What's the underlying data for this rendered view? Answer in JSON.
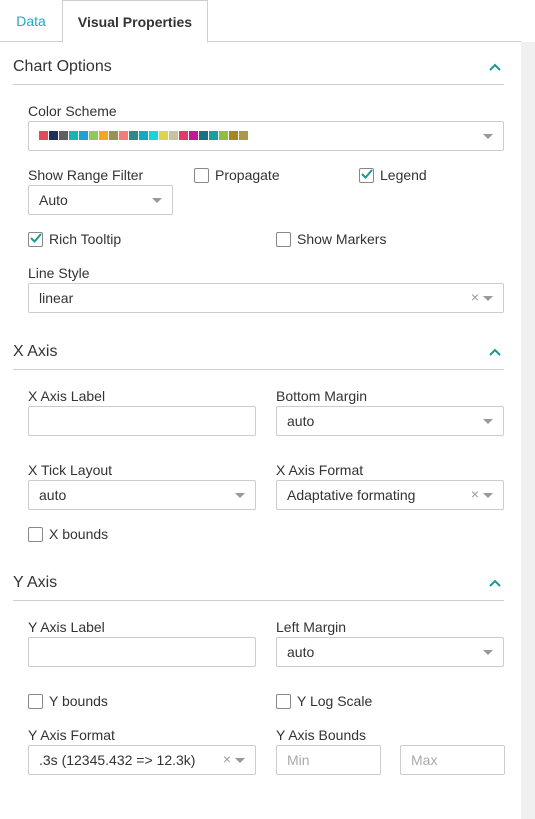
{
  "tabs": [
    {
      "label": "Data"
    },
    {
      "label": "Visual Properties"
    }
  ],
  "sections": {
    "chart_options": {
      "title": "Chart Options",
      "color_scheme": {
        "label": "Color Scheme",
        "colors": [
          "#e34b5a",
          "#1f2e5a",
          "#5f5f5f",
          "#12b8b0",
          "#1fa3d4",
          "#8cca5b",
          "#f2a91b",
          "#9e8f58",
          "#f37b7b",
          "#2b8c87",
          "#13a8c5",
          "#1bd2df",
          "#e0d44b",
          "#c8c39e",
          "#e33a6c",
          "#c4169c",
          "#1b6f87",
          "#15a1a0",
          "#8fc03d",
          "#a8861e",
          "#a89a48"
        ]
      },
      "show_range_filter": {
        "label": "Show Range Filter",
        "value": "Auto"
      },
      "propagate": {
        "label": "Propagate",
        "checked": false
      },
      "legend": {
        "label": "Legend",
        "checked": true
      },
      "rich_tooltip": {
        "label": "Rich Tooltip",
        "checked": true
      },
      "show_markers": {
        "label": "Show Markers",
        "checked": false
      },
      "line_style": {
        "label": "Line Style",
        "value": "linear",
        "clear": "×"
      }
    },
    "x_axis": {
      "title": "X Axis",
      "x_axis_label": {
        "label": "X Axis Label",
        "value": ""
      },
      "bottom_margin": {
        "label": "Bottom Margin",
        "value": "auto"
      },
      "x_tick_layout": {
        "label": "X Tick Layout",
        "value": "auto"
      },
      "x_axis_format": {
        "label": "X Axis Format",
        "value": "Adaptative formating",
        "clear": "×"
      },
      "x_bounds": {
        "label": "X bounds",
        "checked": false
      }
    },
    "y_axis": {
      "title": "Y Axis",
      "y_axis_label": {
        "label": "Y Axis Label",
        "value": ""
      },
      "left_margin": {
        "label": "Left Margin",
        "value": "auto"
      },
      "y_bounds": {
        "label": "Y bounds",
        "checked": false
      },
      "y_log_scale": {
        "label": "Y Log Scale",
        "checked": false
      },
      "y_axis_format": {
        "label": "Y Axis Format",
        "value": ".3s (12345.432 => 12.3k)",
        "clear": "×"
      },
      "y_axis_bounds": {
        "label": "Y Axis Bounds",
        "min_placeholder": "Min",
        "max_placeholder": "Max"
      }
    }
  },
  "colors": {
    "accent": "#20a7c9",
    "chevron": "#1a9a8e",
    "checkmark": "#1a9a8e"
  }
}
